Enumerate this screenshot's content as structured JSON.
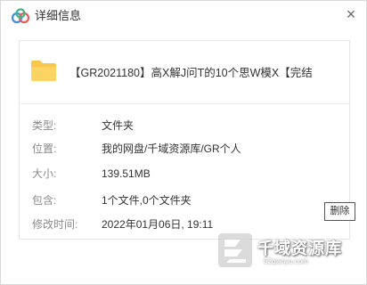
{
  "window": {
    "title": "详细信息",
    "close_glyph": "×"
  },
  "file": {
    "name": "【GR2021180】高X解J问T的10个思W模X【完结"
  },
  "details": [
    {
      "label": "类型:",
      "value": "文件夹"
    },
    {
      "label": "位置:",
      "value": "我的网盘/千域资源库/GR个人"
    },
    {
      "label": "大小:",
      "value": "139.51MB"
    },
    {
      "label": "包含:",
      "value": "1个文件,0个文件夹"
    },
    {
      "label": "修改时间:",
      "value": "2022年01月06日, 19:11"
    }
  ],
  "actions": {
    "delete_label": "删除"
  },
  "watermark": {
    "brand": "千域资源库",
    "url": "52qianyu.com"
  },
  "icons": {
    "app": "baidu-netdisk-icon",
    "folder": "folder-icon",
    "close": "close-icon"
  },
  "colors": {
    "folder": "#f7c64b",
    "label_gray": "#8a8a8a"
  }
}
